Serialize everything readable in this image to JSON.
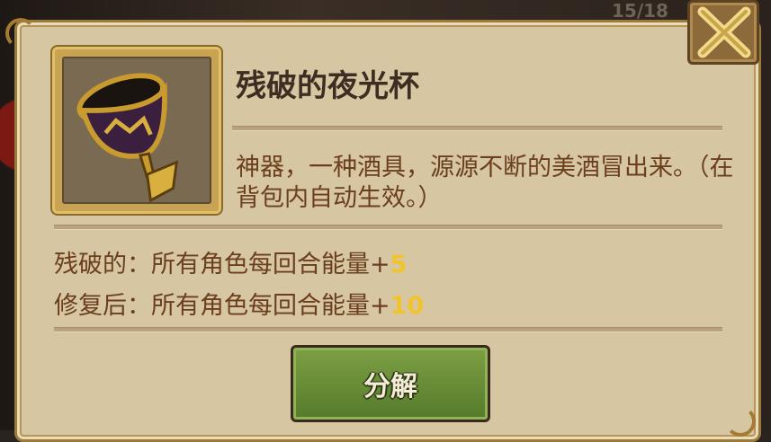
{
  "header": {
    "counter": "15/18"
  },
  "item": {
    "name": "残破的夜光杯",
    "icon": "goblet-icon",
    "description": "神器，一种酒具，源源不断的美酒冒出来。（在背包内自动生效。）"
  },
  "stats": [
    {
      "label": "残破的：所有角色每回合能量+",
      "value": "5"
    },
    {
      "label": "修复后：所有角色每回合能量+",
      "value": "10"
    }
  ],
  "actions": {
    "decompose_label": "分解"
  },
  "colors": {
    "panel": "#d6c6a1",
    "highlight": "#f2c42c",
    "button": "#6b8f36"
  }
}
